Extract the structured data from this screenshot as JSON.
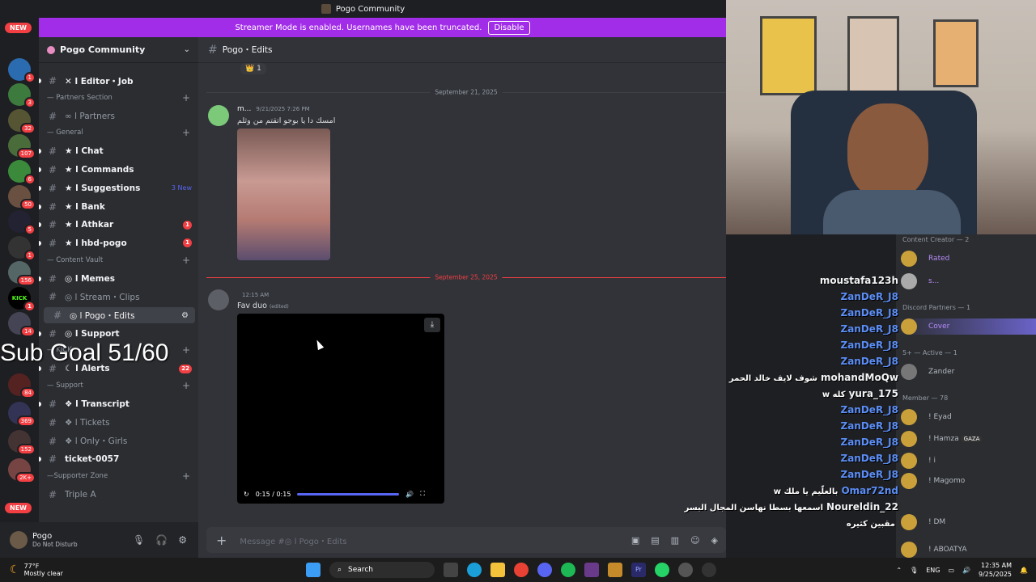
{
  "titlebar": {
    "title": "Pogo Community"
  },
  "banner": {
    "text": "Streamer Mode is enabled. Usernames have been truncated.",
    "button": "Disable"
  },
  "rail": {
    "top_pill": "NEW",
    "bottom_pill": "NEW",
    "badges": [
      "1",
      "2",
      "3",
      "32",
      "107",
      "6",
      "50",
      "5",
      "1",
      "156",
      "1",
      "14",
      "84",
      "369",
      "152",
      "2K+"
    ],
    "kick_label": "KICK"
  },
  "sidebar": {
    "server_name": "Pogo Community",
    "channels": [
      {
        "icon": "✕",
        "name": "Editor・Job",
        "unread": true
      },
      {
        "category": "— Partners Section"
      },
      {
        "icon": "∞",
        "name": "Partners",
        "unread": false
      },
      {
        "category": "— General"
      },
      {
        "icon": "★",
        "name": "Chat",
        "unread": true
      },
      {
        "icon": "★",
        "name": "Commands",
        "unread": true
      },
      {
        "icon": "★",
        "name": "Suggestions",
        "unread": true,
        "new_label": "3 New"
      },
      {
        "icon": "★",
        "name": "Bank",
        "unread": true
      },
      {
        "icon": "★",
        "name": "Athkar",
        "unread": true,
        "badge": "1"
      },
      {
        "icon": "★",
        "name": "hbd-pogo",
        "unread": true,
        "badge": "1"
      },
      {
        "category": "— Content Vault"
      },
      {
        "icon": "◎",
        "name": "Memes",
        "unread": true
      },
      {
        "icon": "◎",
        "name": "Stream・Clips",
        "unread": false
      },
      {
        "icon": "◎",
        "name": "Pogo・Edits",
        "active": true
      },
      {
        "icon": "◎",
        "name": "Support",
        "unread": true
      },
      {
        "category": "— KICK"
      },
      {
        "icon": "☾",
        "name": "Alerts",
        "unread": true,
        "badge": "22"
      },
      {
        "category": "— Support"
      },
      {
        "icon": "❖",
        "name": "Transcript",
        "unread": true
      },
      {
        "icon": "❖",
        "name": "Tickets",
        "unread": false
      },
      {
        "icon": "❖",
        "name": "Only・Girls",
        "unread": false
      },
      {
        "icon": "",
        "name": "ticket-0057",
        "unread": true
      },
      {
        "category": "—Supporter Zone"
      },
      {
        "icon": "",
        "name": "Triple A",
        "unread": false
      }
    ],
    "subgoal": "Sub Goal 51/60"
  },
  "user": {
    "name": "Pogo",
    "status": "Do Not Disturb"
  },
  "chat": {
    "channel": "Pogo・Edits",
    "reaction_count": "1",
    "dates": [
      "September 21, 2025",
      "September 25, 2025"
    ],
    "messages": [
      {
        "author": "m...",
        "time": "9/21/2025 7:26 PM",
        "text": "امسك دا يا بوجو اتقتم من وثلم"
      },
      {
        "author": "",
        "time": "12:15 AM",
        "text": "Fav duo",
        "edited": "(edited)"
      }
    ],
    "video": {
      "time": "0:15 / 0:15",
      "progress": 1.0
    },
    "composer_placeholder": "Message #◎ l Pogo・Edits"
  },
  "members": {
    "headers": [
      "Content Creator — 2",
      "Discord Partners — 1",
      "5+ — Active — 1",
      "Member — 78"
    ],
    "rows": [
      "Rated",
      "s...",
      "Cover",
      "Zander",
      "! Eyad",
      "! Hamza",
      "! i",
      "! Magomo",
      "! DM",
      "! ABOATYA"
    ],
    "tags": [
      "GAZA"
    ]
  },
  "overlay": [
    {
      "name": "moustafa123h",
      "color": "white"
    },
    {
      "name": "ZanDeR_J8",
      "color": "blue"
    },
    {
      "name": "ZanDeR_J8",
      "color": "blue"
    },
    {
      "name": "ZanDeR_J8",
      "color": "blue"
    },
    {
      "name": "ZanDeR_J8",
      "color": "blue"
    },
    {
      "name": "ZanDeR_J8",
      "color": "blue"
    },
    {
      "name": "mohandMoQw",
      "color": "white",
      "text": "شوف لايف خالد الحمر"
    },
    {
      "name": "yura_175",
      "color": "white",
      "text": "w كله"
    },
    {
      "name": "ZanDeR_J8",
      "color": "blue"
    },
    {
      "name": "ZanDeR_J8",
      "color": "blue"
    },
    {
      "name": "ZanDeR_J8",
      "color": "blue"
    },
    {
      "name": "ZanDeR_J8",
      "color": "blue"
    },
    {
      "name": "ZanDeR_J8",
      "color": "blue"
    },
    {
      "name": "Omar72nd",
      "color": "blue",
      "text": "w بالعلّيم يا ملك"
    },
    {
      "name": "Noureldin_22",
      "color": "white",
      "text": "اسمعها بسطا نهاسن المجال البسر"
    },
    {
      "name": "",
      "color": "white",
      "text": "مقبين كثيره"
    }
  ],
  "taskbar": {
    "temp": "77°F",
    "weather": "Mostly clear",
    "search": "Search",
    "lang": "ENG",
    "time": "12:35 AM",
    "date": "9/25/2025",
    "notif_badge": "99+"
  }
}
